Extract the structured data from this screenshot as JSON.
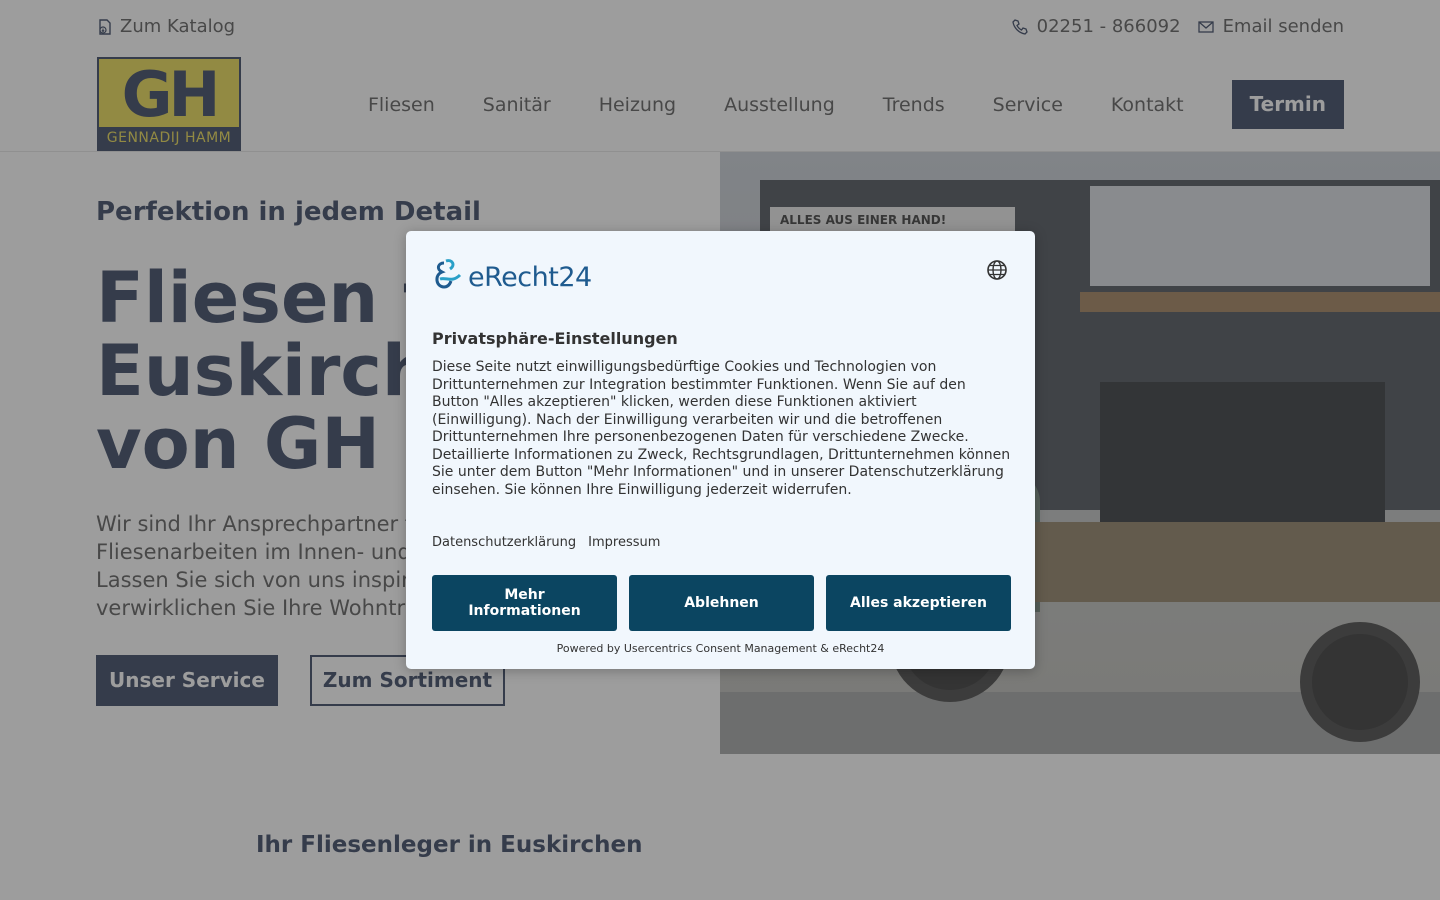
{
  "topbar": {
    "catalog_label": "Zum Katalog",
    "phone": "02251 - 866092",
    "email_label": "Email senden"
  },
  "logo": {
    "letters": "GH",
    "name": "GENNADIJ HAMM"
  },
  "nav": {
    "items": [
      "Fliesen",
      "Sanitär",
      "Heizung",
      "Ausstellung",
      "Trends",
      "Service",
      "Kontakt"
    ],
    "cta": "Termin"
  },
  "hero": {
    "eyebrow": "Perfektion in jedem Detail",
    "headline_lines": [
      "Fliesen fü",
      "Euskirche",
      "von GH F"
    ],
    "lead_lines": [
      "Wir sind Ihr Ansprechpartner f",
      "Fliesenarbeiten im Innen- und",
      "Lassen Sie sich von uns inspiri",
      "verwirklichen Sie Ihre Wohnträ"
    ],
    "primary_button": "Unser Service",
    "secondary_button": "Zum Sortiment",
    "image_banner": "ALLES AUS EINER HAND!"
  },
  "section": {
    "title": "Ihr Fliesenleger in Euskirchen"
  },
  "consent": {
    "brand": "eRecht24",
    "title": "Privatsphäre-Einstellungen",
    "body": "Diese Seite nutzt einwilligungsbedürftige Cookies und Technologien von Drittunternehmen zur Integration bestimmter Funktionen. Wenn Sie auf den Button \"Alles akzeptieren\" klicken, werden diese Funktionen aktiviert (Einwilligung). Nach der Einwilligung verarbeiten wir und die betroffenen Drittunternehmen Ihre personenbezogenen Daten für verschiedene Zwecke. Detaillierte Informationen zu Zweck, Rechtsgrundlagen, Drittunternehmen können Sie unter dem Button \"Mehr Informationen\" und in unserer Datenschutzerklärung einsehen. Sie können Ihre Einwilligung jederzeit widerrufen.",
    "links": [
      "Datenschutzerklärung",
      "Impressum"
    ],
    "buttons": [
      "Mehr Informationen",
      "Ablehnen",
      "Alles akzeptieren"
    ],
    "footer": "Powered by Usercentrics Consent Management & eRecht24"
  },
  "colors": {
    "primary": "#2f3d5a",
    "logo_yellow": "#e9d84a",
    "consent_button": "#0b4561",
    "consent_bg": "#f1f7fd",
    "brand_blue": "#1f5b8f"
  }
}
